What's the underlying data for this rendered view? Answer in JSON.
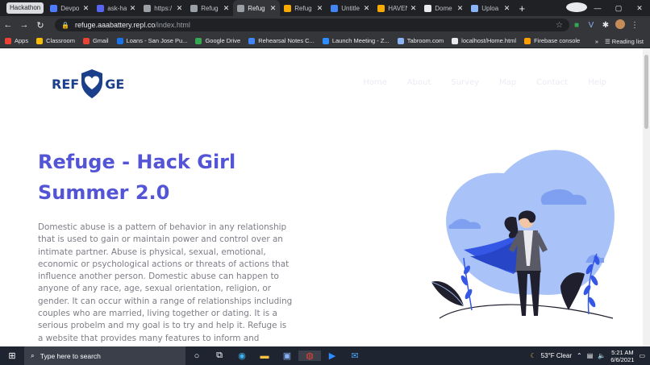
{
  "browser": {
    "tab_group": "Hackathon",
    "tabs": [
      {
        "title": "Devpo",
        "color": "#4d7cff"
      },
      {
        "title": "ask-ha",
        "color": "#5865f2"
      },
      {
        "title": "https:/",
        "color": "#9aa0a6"
      },
      {
        "title": "Refug",
        "color": "#9aa0a6"
      },
      {
        "title": "Refug",
        "color": "#9aa0a6",
        "active": true
      },
      {
        "title": "Refug",
        "color": "#f9ab00"
      },
      {
        "title": "Untitle",
        "color": "#4285f4"
      },
      {
        "title": "HAVEN",
        "color": "#f9ab00"
      },
      {
        "title": "Dome",
        "color": "#e8eaed"
      },
      {
        "title": "Uploa",
        "color": "#8ab4f8"
      }
    ],
    "url_host": "refuge.aaabattery.repl.co",
    "url_path": "/index.html",
    "bookmarks": [
      {
        "label": "Apps",
        "color": "#ea4335"
      },
      {
        "label": "Classroom",
        "color": "#fbbc04"
      },
      {
        "label": "Gmail",
        "color": "#ea4335"
      },
      {
        "label": "Loans - San Jose Pu...",
        "color": "#1a73e8"
      },
      {
        "label": "Google Drive",
        "color": "#34a853"
      },
      {
        "label": "Rehearsal Notes C...",
        "color": "#4285f4"
      },
      {
        "label": "Launch Meeting - Z...",
        "color": "#2d8cff"
      },
      {
        "label": "Tabroom.com",
        "color": "#8ab4f8"
      },
      {
        "label": "localhost/Home.html",
        "color": "#e8eaed"
      },
      {
        "label": "Firebase console",
        "color": "#ffa000"
      }
    ],
    "reading_list": "Reading list"
  },
  "site": {
    "logo_left": "REF",
    "logo_right": "GE",
    "nav": [
      "Home",
      "About",
      "Survey",
      "Map",
      "Contact",
      "Help"
    ],
    "hero_title": "Refuge - Hack Girl Summer 2.0",
    "hero_text": "Domestic abuse is a pattern of behavior in any relationship that is used to gain or maintain power and control over an intimate partner. Abuse is physical, sexual, emotional, economic or psychological actions or threats of actions that influence another person. Domestic abuse can happen to anyone of any race, age, sexual orientation, religion, or gender. It can occur within a range of relationships including couples who are married, living together or dating. It is a serious probelm and my goal is to try and help it. Refuge is a website that provides many features to inform and pottentially save a victim of domestic violence.",
    "colors": {
      "accent": "#5454d6",
      "logo": "#1b3f8b",
      "illustration": "#4a6cf7"
    }
  },
  "taskbar": {
    "search_placeholder": "Type here to search",
    "weather": "53°F  Clear",
    "time": "5:21 AM",
    "date": "6/6/2021"
  }
}
